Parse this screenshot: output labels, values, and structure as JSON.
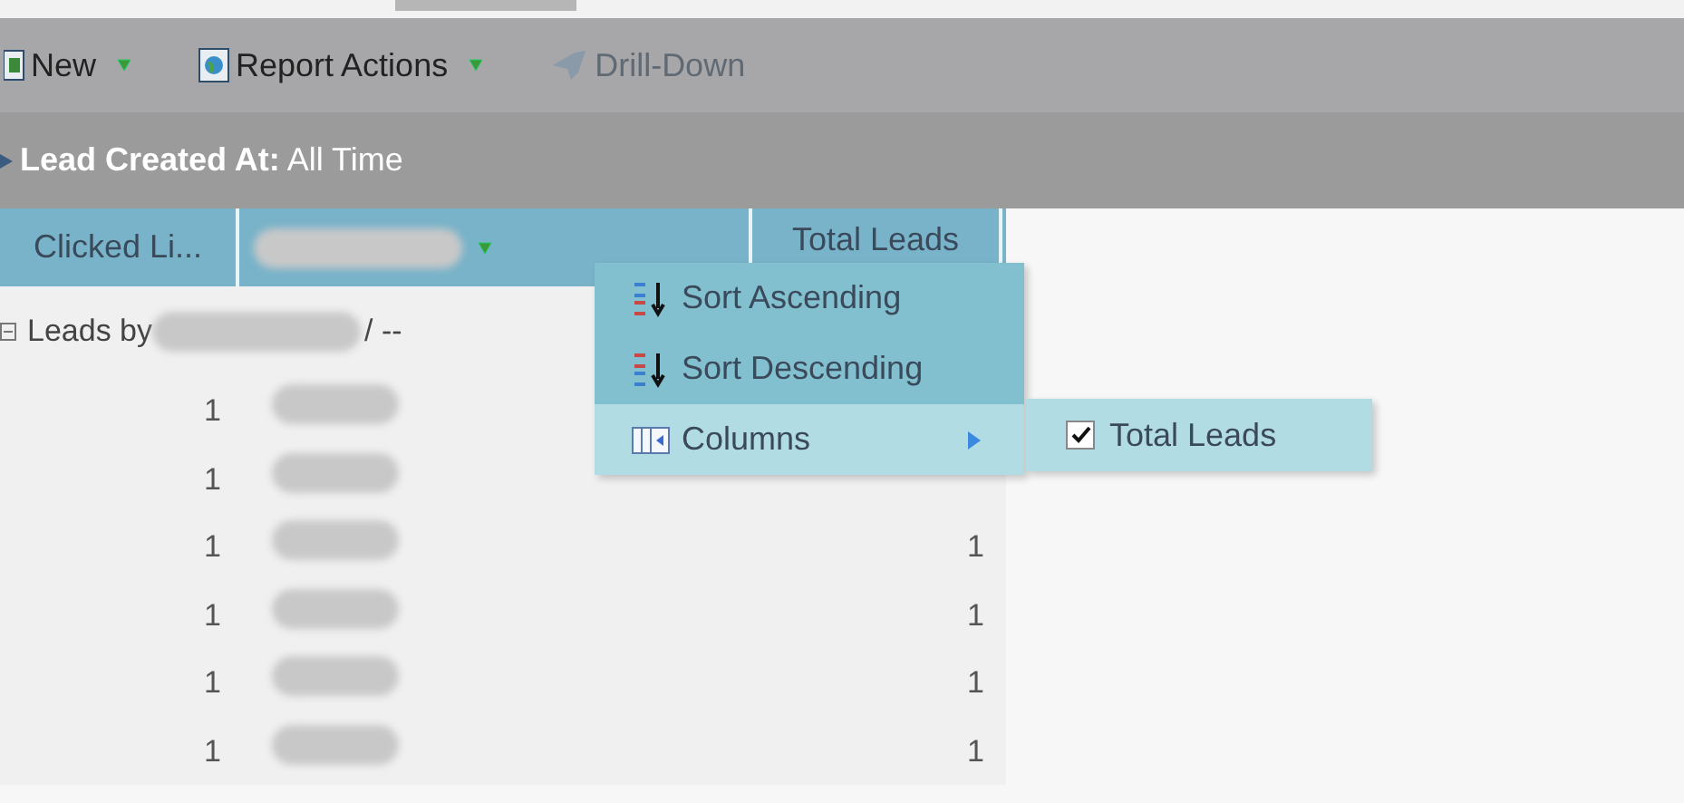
{
  "toolbar": {
    "buttons": [
      {
        "label": "New",
        "kind": "dropdown",
        "disabled": false
      },
      {
        "label": "Report Actions",
        "kind": "dropdown",
        "disabled": false
      },
      {
        "label": "Drill-Down",
        "kind": "plain",
        "disabled": true
      }
    ]
  },
  "filter": {
    "label": "Lead Created At:",
    "value": "All Time"
  },
  "table": {
    "columns": [
      {
        "label": "Clicked Li...",
        "kind": "text"
      },
      {
        "kind": "redacted"
      },
      {
        "label": "Total Leads",
        "kind": "text"
      }
    ],
    "group": {
      "prefix": "Leads by",
      "suffix": "/ --",
      "expanded": true
    },
    "rows": [
      {
        "clicks": "1"
      },
      {
        "clicks": "1"
      },
      {
        "clicks": "1",
        "total": "1"
      },
      {
        "clicks": "1",
        "total": "1"
      },
      {
        "clicks": "1",
        "total": "1"
      },
      {
        "clicks": "1",
        "total": "1"
      }
    ]
  },
  "context_menu": {
    "items": [
      {
        "label": "Sort Ascending",
        "kind": "sort-asc",
        "selected": false
      },
      {
        "label": "Sort Descending",
        "kind": "sort-desc",
        "selected": false
      },
      {
        "label": "Columns",
        "kind": "submenu",
        "selected": true
      }
    ],
    "submenu": {
      "items": [
        {
          "label": "Total Leads",
          "checked": true
        }
      ]
    }
  }
}
